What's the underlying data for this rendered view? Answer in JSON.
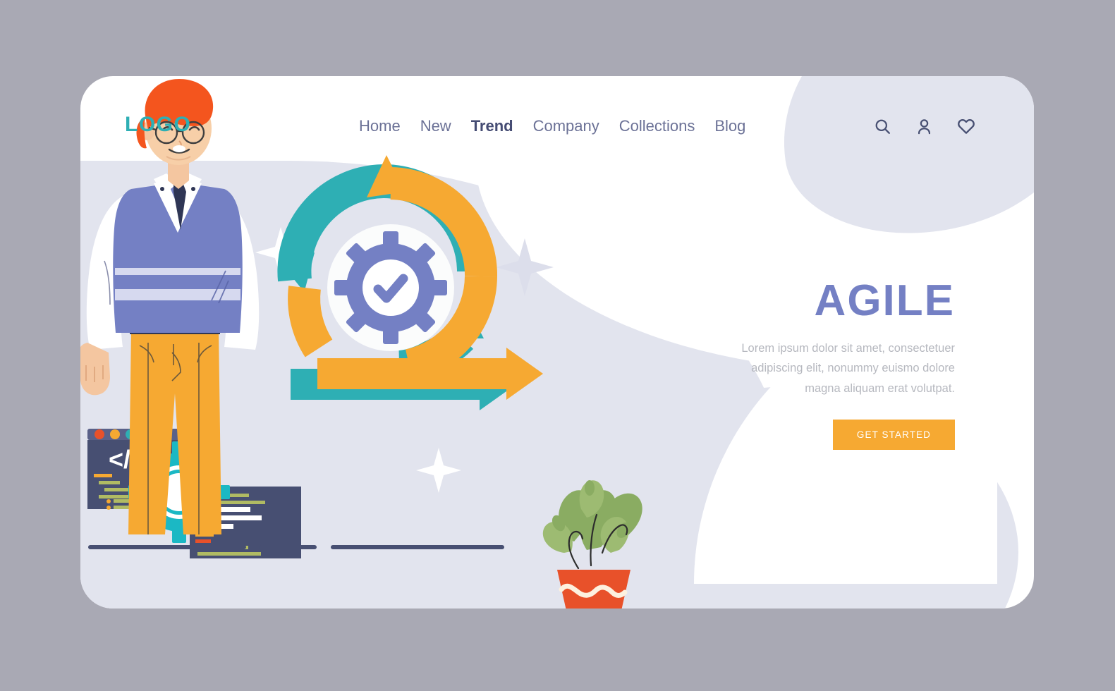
{
  "brand": {
    "logo": "LOGO",
    "logo_color": "#2eafb4"
  },
  "nav": {
    "items": [
      {
        "label": "Home",
        "active": false
      },
      {
        "label": "New",
        "active": false
      },
      {
        "label": "Trend",
        "active": true
      },
      {
        "label": "Company",
        "active": false
      },
      {
        "label": "Collections",
        "active": false
      },
      {
        "label": "Blog",
        "active": false
      }
    ]
  },
  "header_icons": [
    {
      "name": "search-icon"
    },
    {
      "name": "user-icon"
    },
    {
      "name": "heart-icon"
    }
  ],
  "hero": {
    "title": "AGILE",
    "title_color": "#7480c4",
    "body": "Lorem ipsum dolor sit amet, consectetuer adipiscing elit, nonummy euismo dolore magna aliquam erat volutpat.",
    "cta_label": "GET STARTED",
    "cta_color": "#f6a932",
    "cta_text_color": "#ffffff"
  },
  "illustration": {
    "alt": "Man in sweater vest beside agile cycle arrows, code windows, gear and potted plant",
    "code_symbol": "</>",
    "colors": {
      "page_background": "#a9a9b4",
      "card_background": "#ffffff",
      "lavender_shape": "#e2e4ee",
      "teal_arrow": "#2eafb4",
      "orange_arrow": "#f6a932",
      "gear_purple": "#7480c4",
      "code_window": "#474f72",
      "hair_orange": "#f4551e",
      "vest_blue": "#7480c4",
      "pants_yellow": "#f6a932",
      "plant_green": "#8aac62",
      "pot_orange": "#e8512a",
      "ground_line": "#474f72"
    }
  }
}
